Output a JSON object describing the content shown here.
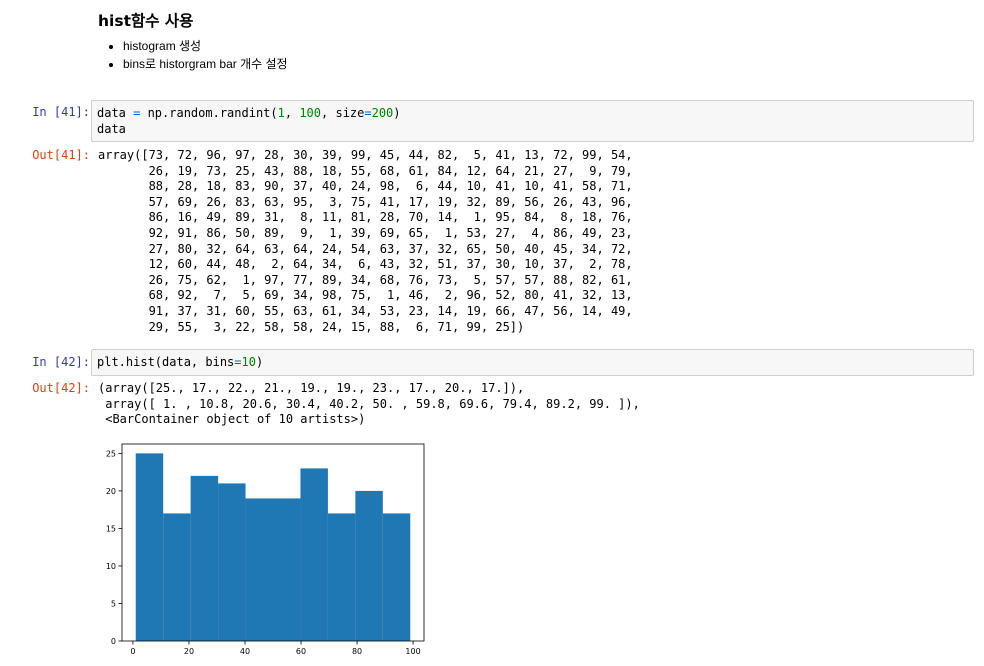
{
  "markdown": {
    "heading": "hist함수 사용",
    "bullets": [
      "histogram 생성",
      "bins로 historgram bar 개수 설정"
    ]
  },
  "cells": [
    {
      "in_prompt": "In [41]:",
      "code_lines": [
        [
          {
            "t": "data "
          },
          {
            "t": "=",
            "c": "op"
          },
          {
            "t": " np.random.randint("
          },
          {
            "t": "1",
            "c": "num"
          },
          {
            "t": ", "
          },
          {
            "t": "100",
            "c": "num"
          },
          {
            "t": ", size"
          },
          {
            "t": "=",
            "c": "op"
          },
          {
            "t": "200",
            "c": "num"
          },
          {
            "t": ")"
          }
        ],
        [
          {
            "t": "data"
          }
        ]
      ],
      "out_prompt": "Out[41]:",
      "output": "array([73, 72, 96, 97, 28, 30, 39, 99, 45, 44, 82,  5, 41, 13, 72, 99, 54,\n       26, 19, 73, 25, 43, 88, 18, 55, 68, 61, 84, 12, 64, 21, 27,  9, 79,\n       88, 28, 18, 83, 90, 37, 40, 24, 98,  6, 44, 10, 41, 10, 41, 58, 71,\n       57, 69, 26, 83, 63, 95,  3, 75, 41, 17, 19, 32, 89, 56, 26, 43, 96,\n       86, 16, 49, 89, 31,  8, 11, 81, 28, 70, 14,  1, 95, 84,  8, 18, 76,\n       92, 91, 86, 50, 89,  9,  1, 39, 69, 65,  1, 53, 27,  4, 86, 49, 23,\n       27, 80, 32, 64, 63, 64, 24, 54, 63, 37, 32, 65, 50, 40, 45, 34, 72,\n       12, 60, 44, 48,  2, 64, 34,  6, 43, 32, 51, 37, 30, 10, 37,  2, 78,\n       26, 75, 62,  1, 97, 77, 89, 34, 68, 76, 73,  5, 57, 57, 88, 82, 61,\n       68, 92,  7,  5, 69, 34, 98, 75,  1, 46,  2, 96, 52, 80, 41, 32, 13,\n       91, 37, 31, 60, 55, 63, 61, 34, 53, 23, 14, 19, 66, 47, 56, 14, 49,\n       29, 55,  3, 22, 58, 58, 24, 15, 88,  6, 71, 99, 25])"
    },
    {
      "in_prompt": "In [42]:",
      "code_lines": [
        [
          {
            "t": "plt.hist(data, bins"
          },
          {
            "t": "=",
            "c": "op"
          },
          {
            "t": "10",
            "c": "num"
          },
          {
            "t": ")"
          }
        ]
      ],
      "out_prompt": "Out[42]:",
      "output": "(array([25., 17., 22., 21., 19., 19., 23., 17., 20., 17.]),\n array([ 1. , 10.8, 20.6, 30.4, 40.2, 50. , 59.8, 69.6, 79.4, 89.2, 99. ]),\n <BarContainer object of 10 artists>)"
    }
  ],
  "chart_data": {
    "type": "bar",
    "bin_edges": [
      1.0,
      10.8,
      20.6,
      30.4,
      40.2,
      50.0,
      59.8,
      69.6,
      79.4,
      89.2,
      99.0
    ],
    "values": [
      25,
      17,
      22,
      21,
      19,
      19,
      23,
      17,
      20,
      17
    ],
    "xlim": [
      -3.9,
      103.9
    ],
    "ylim": [
      0,
      26.25
    ],
    "xticks": [
      0,
      20,
      40,
      60,
      80,
      100
    ],
    "yticks": [
      0,
      5,
      10,
      15,
      20,
      25
    ],
    "bar_color": "#1f77b4",
    "grid": false,
    "title": "",
    "xlabel": "",
    "ylabel": ""
  }
}
